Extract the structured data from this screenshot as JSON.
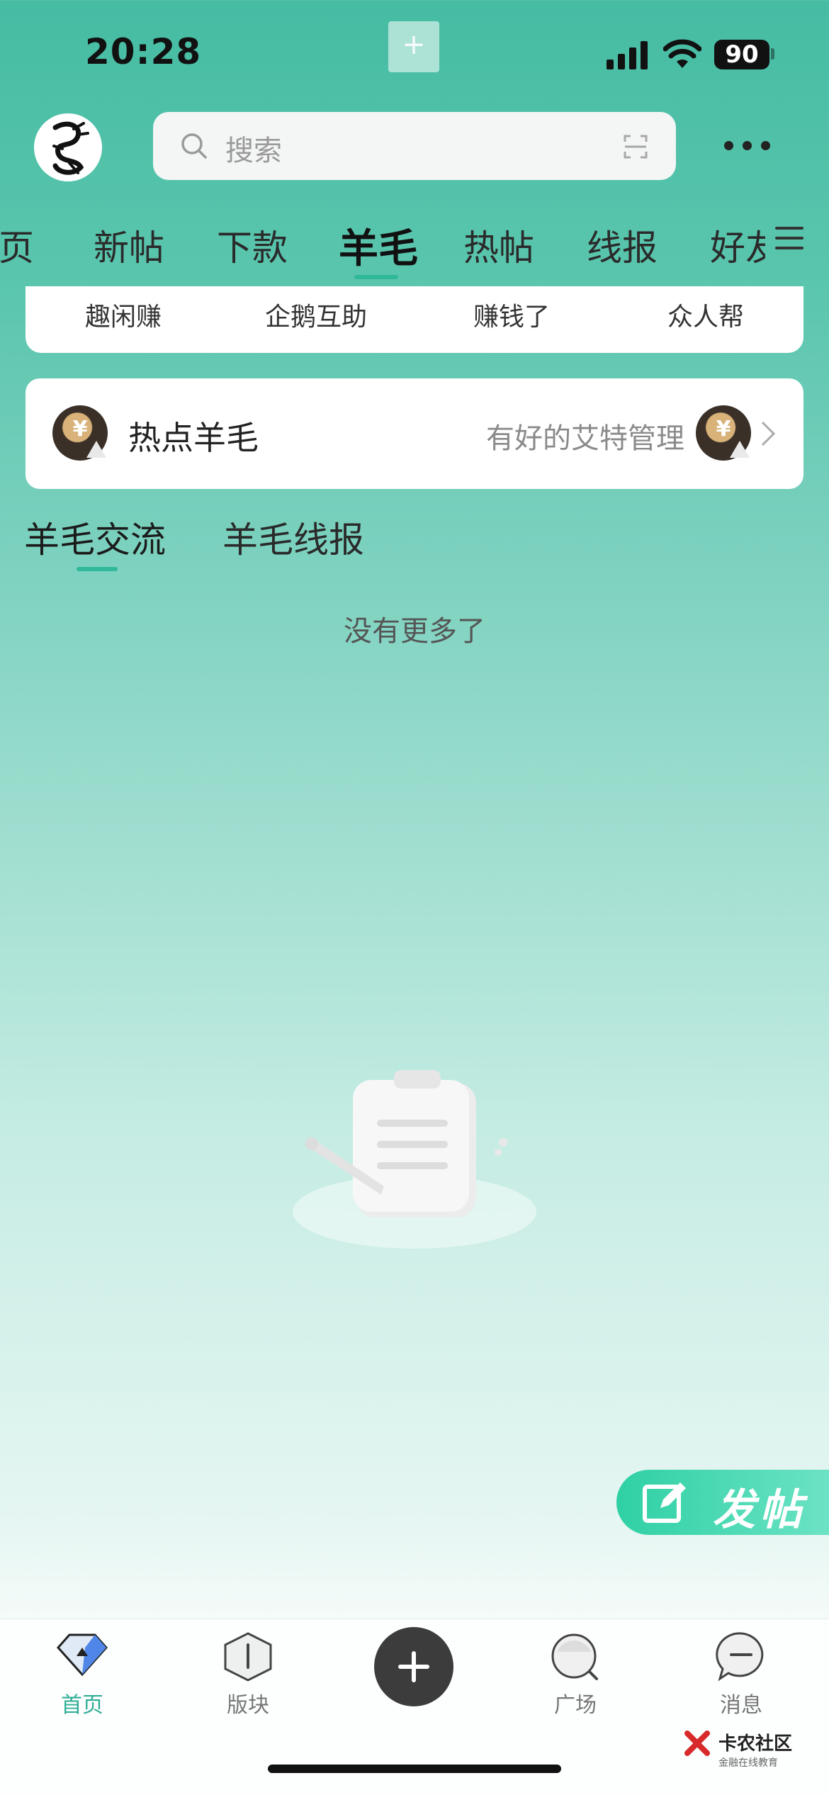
{
  "status_bar": {
    "time": "20:28",
    "battery": "90"
  },
  "header": {
    "search_placeholder": "搜索"
  },
  "tabs": [
    {
      "label": "首页"
    },
    {
      "label": "新帖"
    },
    {
      "label": "下款"
    },
    {
      "label": "羊毛",
      "active": true
    },
    {
      "label": "热帖"
    },
    {
      "label": "线报"
    },
    {
      "label": "好友"
    }
  ],
  "quick_links": [
    "趣闲赚",
    "企鹅互助",
    "赚钱了",
    "众人帮"
  ],
  "hot_card": {
    "title": "热点羊毛",
    "admin": "有好的艾特管理"
  },
  "sub_tabs": [
    {
      "label": "羊毛交流",
      "active": true
    },
    {
      "label": "羊毛线报"
    }
  ],
  "feed_end_text": "没有更多了",
  "post_button": {
    "label": "发帖"
  },
  "bottom_nav": [
    {
      "label": "首页",
      "active": true
    },
    {
      "label": "版块"
    },
    {
      "label": "广场"
    },
    {
      "label": "消息"
    }
  ],
  "watermark": {
    "title": "卡农社区",
    "subtitle": "金融在线教育"
  },
  "colors": {
    "accent": "#2fb89a",
    "fab": "#3c3c3c",
    "post_button": "#2fd0a4"
  }
}
